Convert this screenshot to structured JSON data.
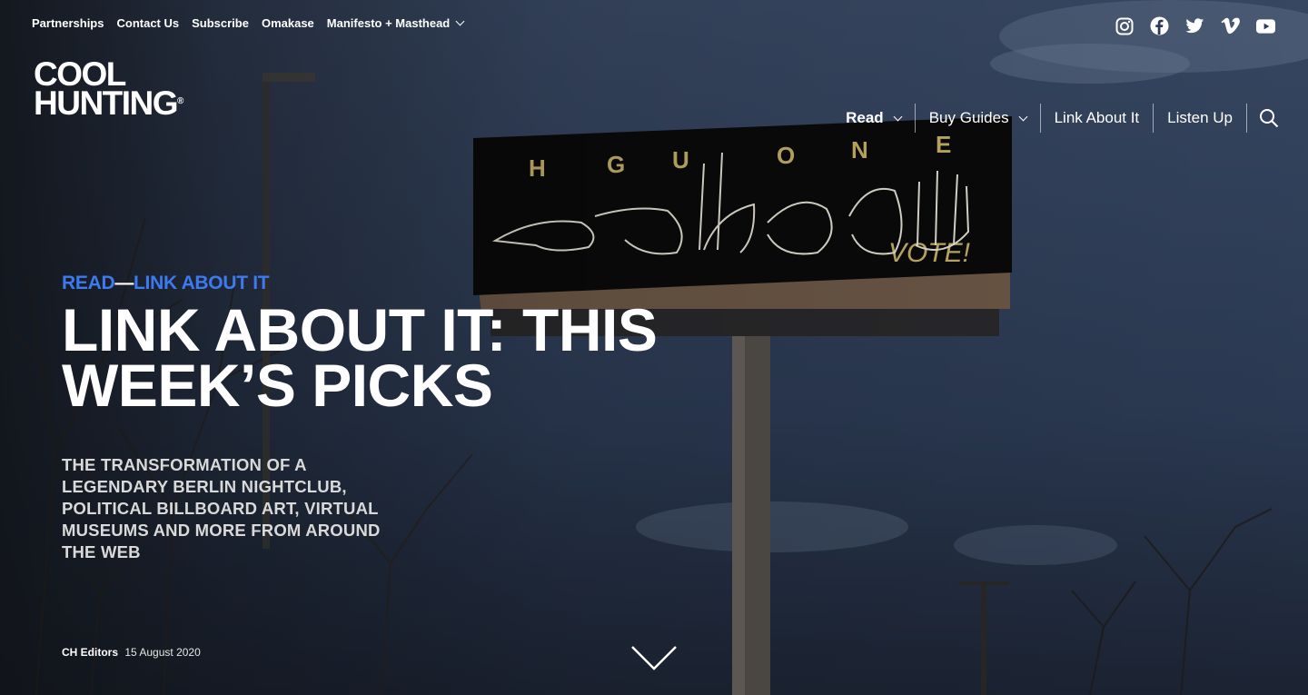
{
  "utility_nav": [
    {
      "label": "Partnerships"
    },
    {
      "label": "Contact Us"
    },
    {
      "label": "Subscribe"
    },
    {
      "label": "Omakase"
    },
    {
      "label": "Manifesto + Masthead",
      "has_dropdown": true
    }
  ],
  "social_icons": [
    "instagram-icon",
    "facebook-icon",
    "twitter-icon",
    "vimeo-icon",
    "youtube-icon"
  ],
  "logo": {
    "line1": "COOL",
    "line2": "HUNTING",
    "mark": "®"
  },
  "main_nav": {
    "read": "Read",
    "buy_guides": "Buy Guides",
    "link_about_it": "Link About It",
    "listen_up": "Listen Up"
  },
  "article": {
    "section": "READ",
    "dash": "—",
    "subsection": "LINK ABOUT IT",
    "title": "LINK ABOUT IT: THIS WEEK’S PICKS",
    "dek": "THE TRANSFORMATION OF A LEGENDARY BERLIN NIGHTCLUB, POLITICAL BILLBOARD ART, VIRTUAL MUSEUMS AND MORE FROM AROUND THE WEB",
    "author": "CH Editors",
    "date": "15 August 2020"
  },
  "hero_image": {
    "billboard_letters": [
      "H",
      "G",
      "U",
      "O",
      "N",
      "E"
    ],
    "billboard_vote": "VOTE!"
  },
  "colors": {
    "accent": "#3d7af0",
    "text": "#ffffff",
    "dek": "#d9d9d9"
  }
}
